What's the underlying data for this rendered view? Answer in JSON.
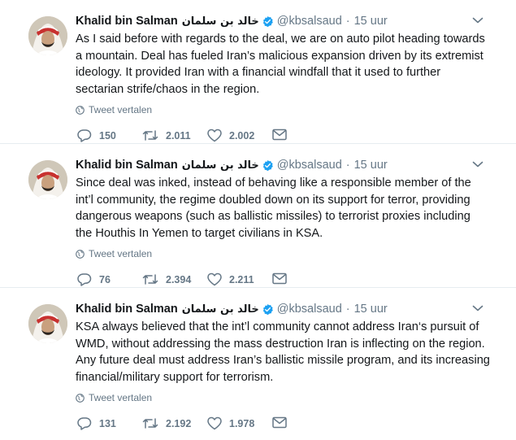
{
  "colors": {
    "verified": "#1da1f2",
    "text": "#14171a",
    "meta": "#657786",
    "divider": "#e6ecf0"
  },
  "icons": {
    "reply": "reply-icon",
    "retweet": "retweet-icon",
    "like": "heart-icon",
    "dm": "envelope-icon",
    "translate": "globe-icon",
    "verified": "verified-badge-icon",
    "caret": "chevron-down-icon"
  },
  "tweets": [
    {
      "name": "Khalid bin Salman",
      "arabic_name": "خالد بن سلمان",
      "handle": "@kbsalsaud",
      "separator": "·",
      "time": "15 uur",
      "text": "As I said before with regards to the deal, we are on auto pilot heading towards a mountain. Deal has fueled Iran’s malicious expansion driven by its extremist ideology. It provided Iran with a financial windfall that it used to further sectarian strife/chaos in the region.",
      "translate": "Tweet vertalen",
      "replies": "150",
      "retweets": "2.011",
      "likes": "2.002"
    },
    {
      "name": "Khalid bin Salman",
      "arabic_name": "خالد بن سلمان",
      "handle": "@kbsalsaud",
      "separator": "·",
      "time": "15 uur",
      "text": "Since deal was inked, instead of behaving like a responsible member of the int’l community, the regime doubled down on its support for terror, providing dangerous weapons (such as ballistic missiles) to terrorist proxies including the Houthis In Yemen to target civilians in KSA.",
      "translate": "Tweet vertalen",
      "replies": "76",
      "retweets": "2.394",
      "likes": "2.211"
    },
    {
      "name": "Khalid bin Salman",
      "arabic_name": "خالد بن سلمان",
      "handle": "@kbsalsaud",
      "separator": "·",
      "time": "15 uur",
      "text": "KSA always believed that the int’l community cannot address Iran‘s pursuit of WMD, without addressing the mass destruction Iran is inflecting on the region. Any future deal must address Iran’s ballistic missile program, and its increasing financial/military support for terrorism.",
      "translate": "Tweet vertalen",
      "replies": "131",
      "retweets": "2.192",
      "likes": "1.978"
    }
  ]
}
